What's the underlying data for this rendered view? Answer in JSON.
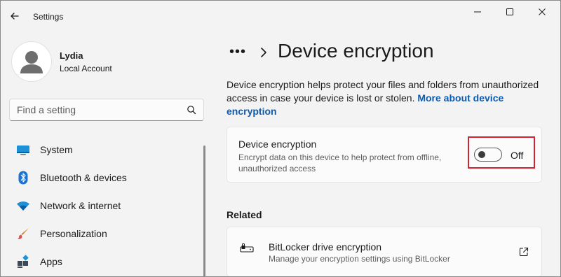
{
  "app": {
    "title": "Settings"
  },
  "user": {
    "name": "Lydia",
    "account_type": "Local Account"
  },
  "search": {
    "placeholder": "Find a setting",
    "value": ""
  },
  "sidebar": {
    "items": [
      {
        "label": "System",
        "icon": "system-icon"
      },
      {
        "label": "Bluetooth & devices",
        "icon": "bluetooth-icon"
      },
      {
        "label": "Network & internet",
        "icon": "wifi-icon"
      },
      {
        "label": "Personalization",
        "icon": "brush-icon"
      },
      {
        "label": "Apps",
        "icon": "apps-icon"
      }
    ]
  },
  "breadcrumb": {
    "ellipsis": "•••"
  },
  "page": {
    "title": "Device encryption",
    "description": "Device encryption helps protect your files and folders from unauthorized access in case your device is lost or stolen. ",
    "description_link": "More about device encryption"
  },
  "encryption_card": {
    "title": "Device encryption",
    "subtitle": "Encrypt data on this device to help protect from offline, unauthorized access",
    "toggle_state": "Off",
    "toggle_on": false
  },
  "related": {
    "heading": "Related",
    "items": [
      {
        "title": "BitLocker drive encryption",
        "subtitle": "Manage your encryption settings using BitLocker",
        "icon": "bitlocker-icon"
      }
    ]
  },
  "colors": {
    "accent_link": "#0b5bb0",
    "highlight_box": "#d32232",
    "background": "#f3f3f3",
    "card": "#fbfbfb"
  }
}
